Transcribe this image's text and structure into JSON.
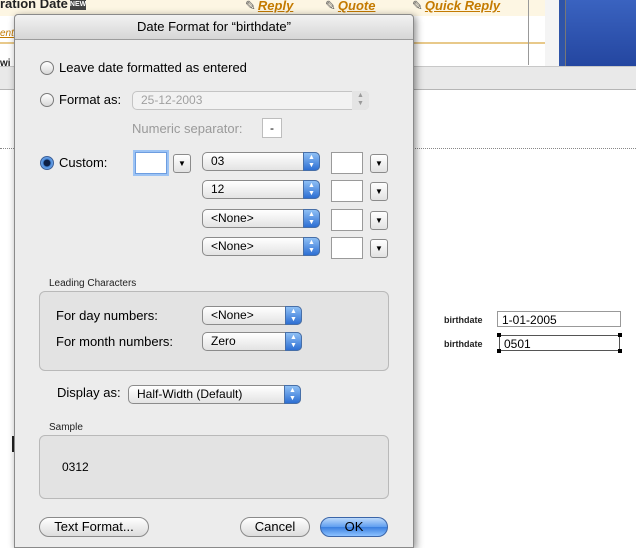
{
  "background": {
    "header_title": "ration Date",
    "links": [
      "Reply",
      "Quote",
      "Quick Reply"
    ],
    "left_fragment_1": "ent",
    "left_fragment_2": "wi",
    "fields": [
      {
        "label": "birthdate",
        "value": "1-01-2005"
      },
      {
        "label": "birthdate",
        "value": "0501"
      }
    ]
  },
  "dialog": {
    "title": "Date Format for “birthdate”",
    "leave_as_entered": "Leave date formatted as entered",
    "format_as_label": "Format as:",
    "format_as_value": "25-12-2003",
    "numeric_separator_label": "Numeric separator:",
    "numeric_separator_value": "-",
    "custom_label": "Custom:",
    "custom_rows": [
      {
        "value": "03"
      },
      {
        "value": "12"
      },
      {
        "value": "<None>"
      },
      {
        "value": "<None>"
      }
    ],
    "leading": {
      "title": "Leading Characters",
      "day_label": "For day numbers:",
      "day_value": "<None>",
      "month_label": "For month numbers:",
      "month_value": "Zero"
    },
    "display_as_label": "Display as:",
    "display_as_value": "Half-Width (Default)",
    "sample": {
      "title": "Sample",
      "value": "0312"
    },
    "buttons": {
      "text_format": "Text Format...",
      "cancel": "Cancel",
      "ok": "OK"
    }
  }
}
